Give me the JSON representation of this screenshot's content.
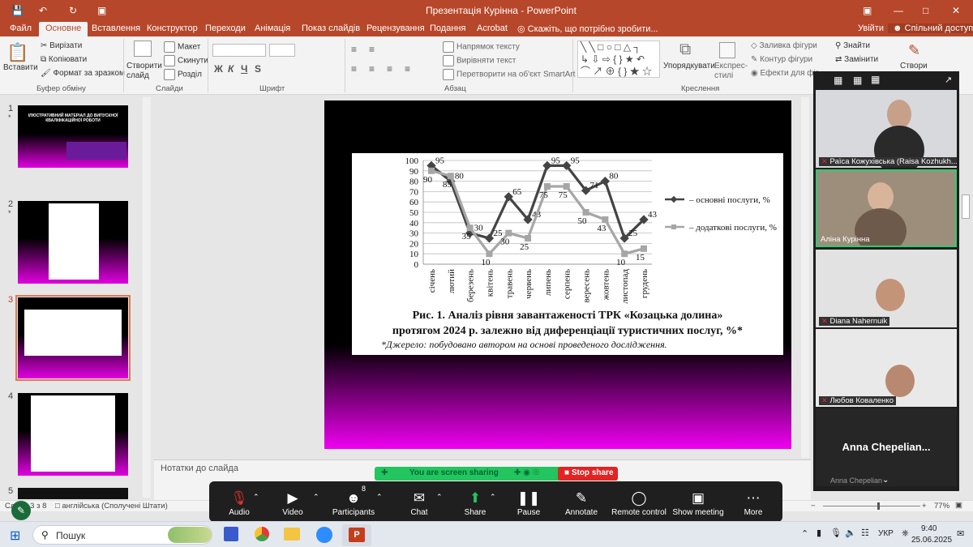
{
  "window": {
    "title": "Презентація Курінна - PowerPoint"
  },
  "tabs": [
    "Файл",
    "Основне",
    "Вставлення",
    "Конструктор",
    "Переходи",
    "Анімація",
    "Показ слайдів",
    "Рецензування",
    "Подання",
    "Acrobat"
  ],
  "tell_me": "Скажіть, що потрібно зробити...",
  "signin": "Увійти",
  "share": "Спільний доступ",
  "ribbon": {
    "paste": "Вставити",
    "cut": "Вирізати",
    "copy": "Копіювати",
    "format_painter": "Формат за зразком",
    "group_clipboard": "Буфер обміну",
    "new_slide": "Створити слайд",
    "layout": "Макет",
    "reset": "Скинути",
    "section": "Розділ",
    "group_slides": "Слайди",
    "group_font": "Шрифт",
    "group_paragraph": "Абзац",
    "text_direction": "Напрямок тексту",
    "align_text": "Вирівняти текст",
    "smartart": "Перетворити на об'єкт SmartArt",
    "arrange": "Упорядкувати",
    "quick_styles": "Експрес-стилі",
    "group_drawing": "Креслення",
    "shape_fill": "Заливка фігури",
    "shape_outline": "Контур фігури",
    "shape_effects": "Ефекти для фіг",
    "find": "Знайти",
    "replace": "Замінити",
    "create": "Створи"
  },
  "thumbnails": [
    {
      "num": "1"
    },
    {
      "num": "2"
    },
    {
      "num": "3"
    },
    {
      "num": "4"
    },
    {
      "num": "5"
    }
  ],
  "thumb1_text": "ІЛЮСТРАТИВНИЙ МАТЕРІАЛ ДО ВИПУСКНОЇ КВАЛІФІКАЦІЙНОЇ РОБОТИ",
  "chart_data": {
    "type": "line",
    "categories": [
      "січень",
      "лютий",
      "березень",
      "квітень",
      "травень",
      "червень",
      "липень",
      "серпень",
      "вересень",
      "жовтень",
      "листопад",
      "грудень"
    ],
    "series": [
      {
        "name": "– основні послуги, %",
        "values": [
          95,
          80,
          30,
          25,
          65,
          43,
          95,
          95,
          71,
          80,
          25,
          43
        ],
        "color": "#444444"
      },
      {
        "name": "– додаткові послуги, %",
        "values": [
          90,
          85,
          35,
          10,
          30,
          25,
          75,
          75,
          50,
          43,
          10,
          15
        ],
        "color": "#a6a6a6"
      }
    ],
    "ylim": [
      0,
      100
    ],
    "yticks": [
      "0",
      "10",
      "20",
      "30",
      "40",
      "50",
      "60",
      "70",
      "80",
      "90",
      "100"
    ],
    "labels_main": [
      "95",
      "80",
      "30",
      "25",
      "65",
      "43",
      "95",
      "95",
      "71",
      "80",
      "25",
      "43"
    ],
    "labels_add": [
      "90",
      "85",
      "35",
      "10",
      "30",
      "25",
      "75",
      "75",
      "50",
      "43",
      "10",
      "15"
    ],
    "caption1": "Рис. 1. Аналіз рівня завантаженості ТРК «Козацька долина»",
    "caption2": "протягом 2024 р. залежно від диференціації туристичних послуг, %*",
    "source": "*Джерело: побудовано автором на основі проведеного дослідження."
  },
  "notes_placeholder": "Нотатки до слайда",
  "status": {
    "slide": "Слайд 3 з 8",
    "lang": "англійська (Сполучені Штати)",
    "zoom": "77%"
  },
  "zoom": {
    "participants": [
      {
        "name": "Раїса Кожухівська (Raisa Kozhukh..."
      },
      {
        "name": "Аліна Курінна"
      },
      {
        "name": "Diana Nahernuik"
      },
      {
        "name": "Любов Коваленко"
      }
    ],
    "speaker": "Anna  Chepelian...",
    "speaker_small": "Anna Chepelian",
    "sharing_text": "You are screen sharing",
    "stop_share": "Stop share",
    "participants_count": "8",
    "buttons": [
      "Audio",
      "Video",
      "Participants",
      "Chat",
      "Share",
      "Pause",
      "Annotate",
      "Remote control",
      "Show meeting",
      "More"
    ]
  },
  "taskbar": {
    "search": "Пошук",
    "lang": "УКР",
    "time": "9:40",
    "date": "25.06.2025"
  }
}
